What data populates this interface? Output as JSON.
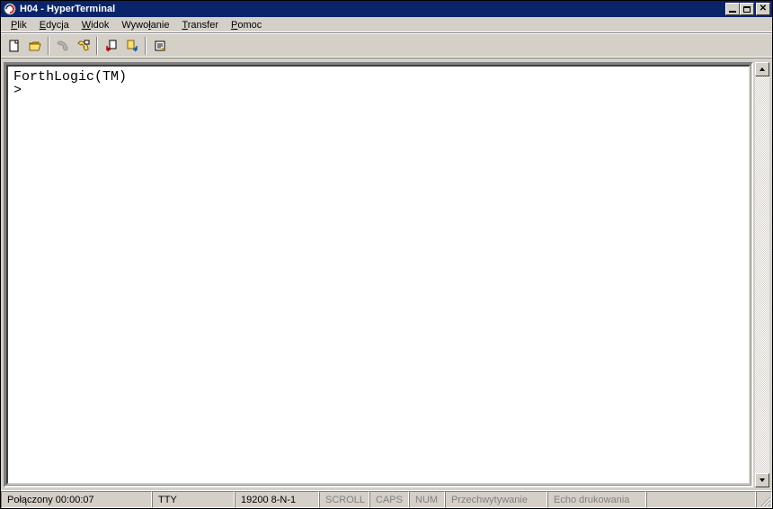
{
  "title": "H04 - HyperTerminal",
  "menu": {
    "file": {
      "label": "Plik",
      "accel_index": 0
    },
    "edit": {
      "label": "Edycja",
      "accel_index": 0
    },
    "view": {
      "label": "Widok",
      "accel_index": 0
    },
    "call": {
      "label": "Wywołanie",
      "accel_index": 4
    },
    "transfer": {
      "label": "Transfer",
      "accel_index": 0
    },
    "help": {
      "label": "Pomoc",
      "accel_index": 0
    }
  },
  "toolbar": {
    "new": "new-file-icon",
    "open": "open-folder-icon",
    "call": "phone-icon",
    "disconnect": "phone-hangup-icon",
    "send": "send-file-icon",
    "receive": "receive-file-icon",
    "properties": "properties-icon"
  },
  "terminal": {
    "line1": "ForthLogic(TM)",
    "line2": ">"
  },
  "status": {
    "connection": "Połączony 00:00:07",
    "emulation": "TTY",
    "port": "19200 8-N-1",
    "scroll": "SCROLL",
    "caps": "CAPS",
    "num": "NUM",
    "capture": "Przechwytywanie",
    "echo": "Echo drukowania"
  },
  "colors": {
    "titlebar": "#0a246a",
    "face": "#d4d0c8"
  }
}
